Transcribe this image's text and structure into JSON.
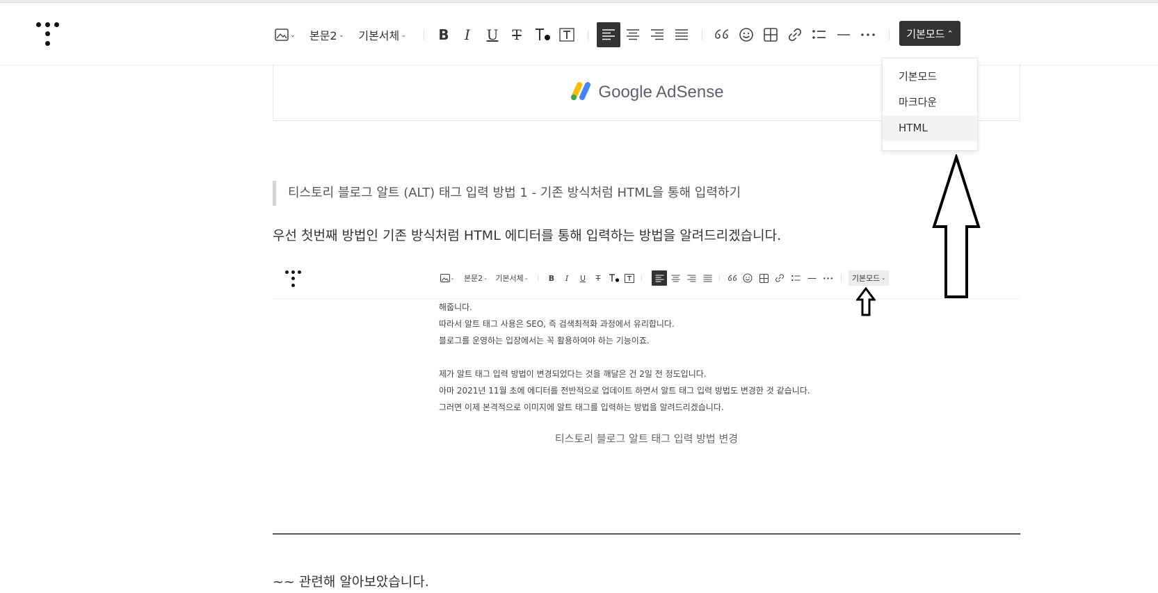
{
  "toolbar": {
    "paragraph_style": "본문2",
    "font_family": "기본서체",
    "mode_label": "기본모드"
  },
  "mode_dropdown": {
    "options": [
      "기본모드",
      "마크다운",
      "HTML"
    ],
    "highlighted": "HTML"
  },
  "content": {
    "ad_label": "Google AdSense",
    "quote_heading": "티스토리 블로그 알트 (ALT) 태그 입력 방법 1 - 기존 방식처럼 HTML을 통해 입력하기",
    "paragraph": "우선 첫번째 방법인 기존 방식처럼 HTML 에디터를 통해 입력하는 방법을 알려드리겠습니다.",
    "closing": "~~ 관련해 알아보았습니다."
  },
  "embedded_screenshot": {
    "toolbar": {
      "paragraph_style": "본문2",
      "font_family": "기본서체",
      "mode_label": "기본모드"
    },
    "lines": [
      "해줍니다.",
      "따라서 알트 태그 사용은 SEO, 즉 검색최적화 과정에서 유리합니다.",
      "블로그를 운영하는 입장에서는 꼭 활용하여야 하는 기능이죠.",
      "",
      "제가 알트 태그 입력 방법이 변경되었다는 것을 깨달은 건 2일 전 정도입니다.",
      "아마 2021년 11월 초에 에디터를 전반적으로 업데이트 하면서 알트 태그 입력 방법도 변경한 것 같습니다.",
      "그러면 이제 본격적으로 이미지에 알트 태그를 입력하는 방법을 알려드리겠습니다."
    ],
    "caption": "티스토리 블로그 알트 태그 입력 방법 변경"
  },
  "colors": {
    "accent_dark": "#333333",
    "adsense_blue": "#4285F4",
    "adsense_yellow": "#FBBC04",
    "adsense_green": "#34A853"
  }
}
